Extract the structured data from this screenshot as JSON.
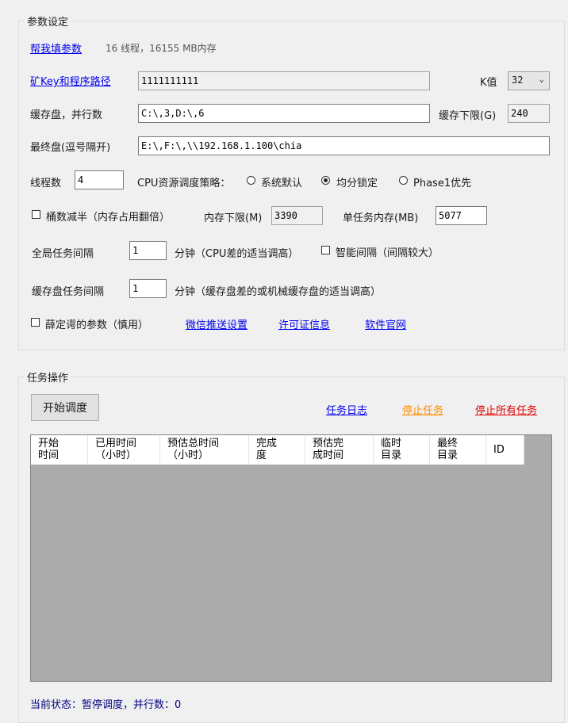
{
  "params": {
    "legend": "参数设定",
    "help_link": "帮我填参数",
    "sysinfo": "16 线程，16155 MB内存",
    "key_link": "矿Key和程序路径",
    "key_value": "1111111111",
    "k_label": "K值",
    "k_value": "32",
    "cache_label": "缓存盘，并行数",
    "cache_value": "C:\\,3,D:\\,6",
    "cache_min_label": "缓存下限(G)",
    "cache_min_value": "240",
    "final_label": "最终盘(逗号隔开)",
    "final_value": "E:\\,F:\\,\\\\192.168.1.100\\chia",
    "threads_label": "线程数",
    "threads_value": "4",
    "cpu_policy_label": "CPU资源调度策略：",
    "radio_default": "系统默认",
    "radio_lock": "均分锁定",
    "radio_phase1": "Phase1优先",
    "bucket_label": "桶数减半（内存占用翻倍）",
    "mem_min_label": "内存下限(M)",
    "mem_min_value": "3390",
    "task_mem_label": "单任务内存(MB)",
    "task_mem_value": "5077",
    "global_interval_label": "全局任务间隔",
    "global_interval_value": "1",
    "global_interval_hint": "分钟（CPU差的适当调高）",
    "smart_interval_label": "智能间隔（间隔较大）",
    "cache_interval_label": "缓存盘任务间隔",
    "cache_interval_value": "1",
    "cache_interval_hint": "分钟（缓存盘差的或机械缓存盘的适当调高）",
    "xue_label": "薛定谔的参数（慎用）",
    "wechat_link": "微信推送设置",
    "license_link": "许可证信息",
    "website_link": "软件官网"
  },
  "tasks": {
    "legend": "任务操作",
    "start_button": "开始调度",
    "log_link": "任务日志",
    "stop_link": "停止任务",
    "stop_all_link": "停止所有任务",
    "columns": [
      "开始\n时间",
      "已用时间\n（小时）",
      "预估总时间\n（小时）",
      "完成\n度",
      "预估完\n成时间",
      "临时\n目录",
      "最终\n目录",
      "ID"
    ],
    "status": "当前状态：暂停调度，并行数：0"
  },
  "colors": {
    "link": "#0000ee",
    "stop_orange": "#ff8c00",
    "stop_all_red": "#e00000",
    "list_bg": "#ababab",
    "status_text": "#000080"
  }
}
